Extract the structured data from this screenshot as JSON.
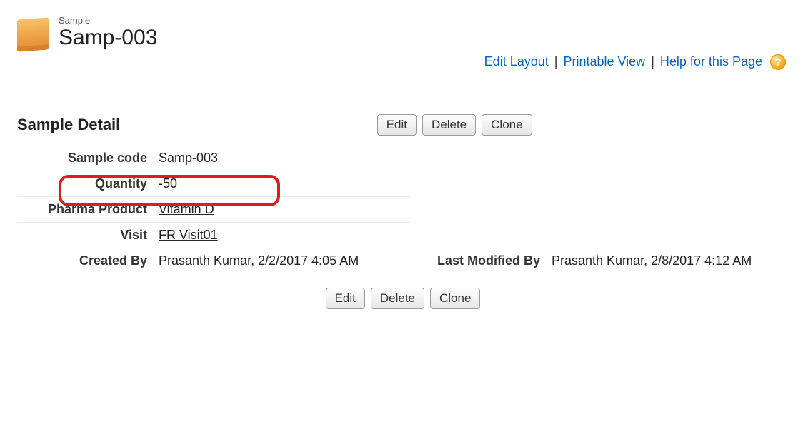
{
  "header": {
    "type_label": "Sample",
    "record_name": "Samp-003"
  },
  "top_links": {
    "edit_layout": "Edit Layout",
    "printable_view": "Printable View",
    "help_for_page": "Help for this Page"
  },
  "section": {
    "title": "Sample Detail"
  },
  "buttons": {
    "edit": "Edit",
    "delete": "Delete",
    "clone": "Clone"
  },
  "fields": {
    "sample_code": {
      "label": "Sample code",
      "value": "Samp-003"
    },
    "quantity": {
      "label": "Quantity",
      "value": "-50"
    },
    "pharma_product": {
      "label": "Pharma Product",
      "value": "Vitamin D"
    },
    "visit": {
      "label": "Visit",
      "value": "FR Visit01"
    },
    "created_by": {
      "label": "Created By",
      "user": "Prasanth Kumar",
      "datetime": "2/2/2017 4:05 AM"
    },
    "last_modified_by": {
      "label": "Last Modified By",
      "user": "Prasanth Kumar",
      "datetime": "2/8/2017 4:12 AM"
    }
  }
}
